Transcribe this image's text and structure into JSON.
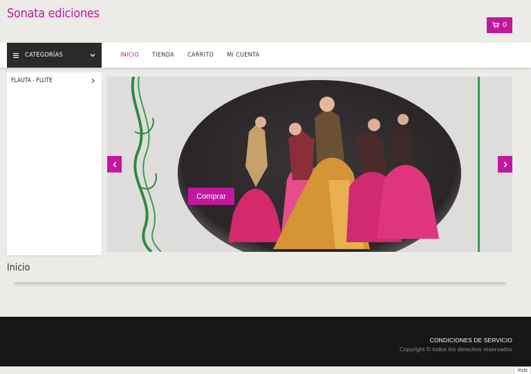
{
  "colors": {
    "accent": "#c2189b",
    "dark": "#2a2a2a",
    "footer": "#161616"
  },
  "header": {
    "brand": "Sonata ediciones",
    "cart_count": "0",
    "cart_icon": "cart-icon"
  },
  "nav": {
    "categories_label": "CATEGORÍAS",
    "categories_icon": "menu-icon",
    "links": [
      {
        "label": "INICIO"
      },
      {
        "label": "TIENDA"
      },
      {
        "label": "CARRITO"
      },
      {
        "label": "MI CUENTA"
      }
    ]
  },
  "sidebar": {
    "items": [
      {
        "label": "FLAUTA - FLUTE"
      }
    ]
  },
  "slider": {
    "button_label": "Comprar",
    "prev_icon": "chevron-left-icon",
    "next_icon": "chevron-right-icon"
  },
  "main": {
    "title": "Inicio"
  },
  "footer": {
    "terms": "CONDICIONES DE SERVICIO",
    "copyright": "Copyright © todos los derechos reservados"
  },
  "policy_tab": "Polít"
}
